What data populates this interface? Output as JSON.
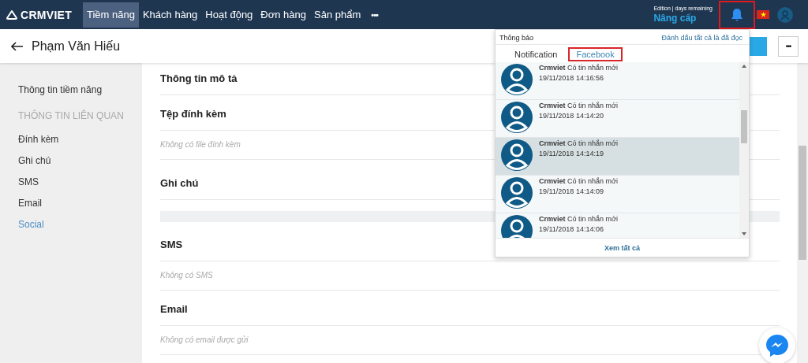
{
  "nav": {
    "logo": "CRMVIET",
    "items": [
      {
        "label": "Tiềm năng",
        "selected": true
      },
      {
        "label": "Khách hàng",
        "selected": false
      },
      {
        "label": "Hoạt động",
        "selected": false
      },
      {
        "label": "Đơn hàng",
        "selected": false
      },
      {
        "label": "Sản phẩm",
        "selected": false
      }
    ],
    "more": "•••",
    "edition": "Edition | days remaining",
    "upgrade": "Nâng cấp",
    "bell_annotated": true
  },
  "header": {
    "title": "Phạm Văn Hiếu",
    "more": "•••"
  },
  "sidebar": {
    "items": [
      {
        "label": "Thông tin tiềm năng",
        "kind": "link",
        "selected": false
      },
      {
        "label": "THÔNG TIN LIÊN QUAN",
        "kind": "heading"
      },
      {
        "label": "Đính kèm",
        "kind": "link",
        "selected": false
      },
      {
        "label": "Ghi chú",
        "kind": "link",
        "selected": false
      },
      {
        "label": "SMS",
        "kind": "link",
        "selected": false
      },
      {
        "label": "Email",
        "kind": "link",
        "selected": false
      },
      {
        "label": "Social",
        "kind": "link",
        "selected": true
      }
    ]
  },
  "sections": [
    {
      "title": "Thông tin mô tả",
      "kind": "plain"
    },
    {
      "title": "Tệp đính kèm",
      "kind": "empty",
      "empty_text": "Không có file đính kèm"
    },
    {
      "title": "Ghi chú",
      "kind": "note"
    },
    {
      "title": "SMS",
      "kind": "empty",
      "empty_text": "Không có SMS"
    },
    {
      "title": "Email",
      "kind": "empty",
      "empty_text": "Không có email được gửi"
    }
  ],
  "notifications": {
    "title": "Thông báo",
    "mark_all": "Đánh dấu tất cả là đã đọc",
    "tabs": [
      {
        "label": "Notification",
        "selected": false
      },
      {
        "label": "Facebook",
        "selected": true
      }
    ],
    "items": [
      {
        "sender": "Crmviet",
        "message": "Có tin nhắn mới",
        "time": "19/11/2018 14:16:56",
        "highlighted": false
      },
      {
        "sender": "Crmviet",
        "message": "Có tin nhắn mới",
        "time": "19/11/2018 14:14:20",
        "highlighted": false
      },
      {
        "sender": "Crmviet",
        "message": "Có tin nhắn mới",
        "time": "19/11/2018 14:14:19",
        "highlighted": true
      },
      {
        "sender": "Crmviet",
        "message": "Có tin nhắn mới",
        "time": "19/11/2018 14:14:09",
        "highlighted": false
      },
      {
        "sender": "Crmviet",
        "message": "Có tin nhắn mới",
        "time": "19/11/2018 14:14:06",
        "highlighted": false
      }
    ],
    "see_all": "Xem tất cả"
  }
}
